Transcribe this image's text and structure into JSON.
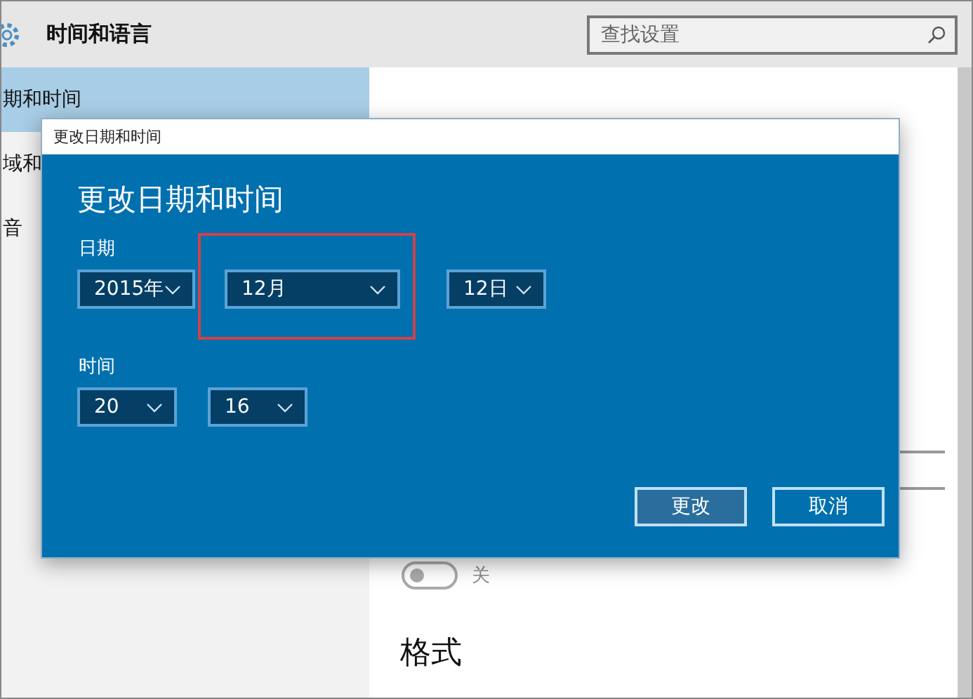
{
  "window": {
    "title": "时间和语言"
  },
  "search": {
    "placeholder": "查找设置"
  },
  "sidebar": {
    "items": [
      {
        "label": "期和时间",
        "selected": true
      },
      {
        "label": "域和",
        "selected": false
      },
      {
        "label": "音",
        "selected": false
      }
    ]
  },
  "content": {
    "toggle": {
      "on": false,
      "label": "关"
    },
    "section": "格式"
  },
  "dialog": {
    "title": "更改日期和时间",
    "heading": "更改日期和时间",
    "date_label": "日期",
    "date_fields": [
      "2015年",
      "12月",
      "12日"
    ],
    "time_label": "时间",
    "time_fields": [
      "20",
      "16"
    ],
    "buttons": [
      {
        "label": "更改",
        "kind": "primary"
      },
      {
        "label": "取消",
        "kind": "secondary"
      }
    ]
  }
}
